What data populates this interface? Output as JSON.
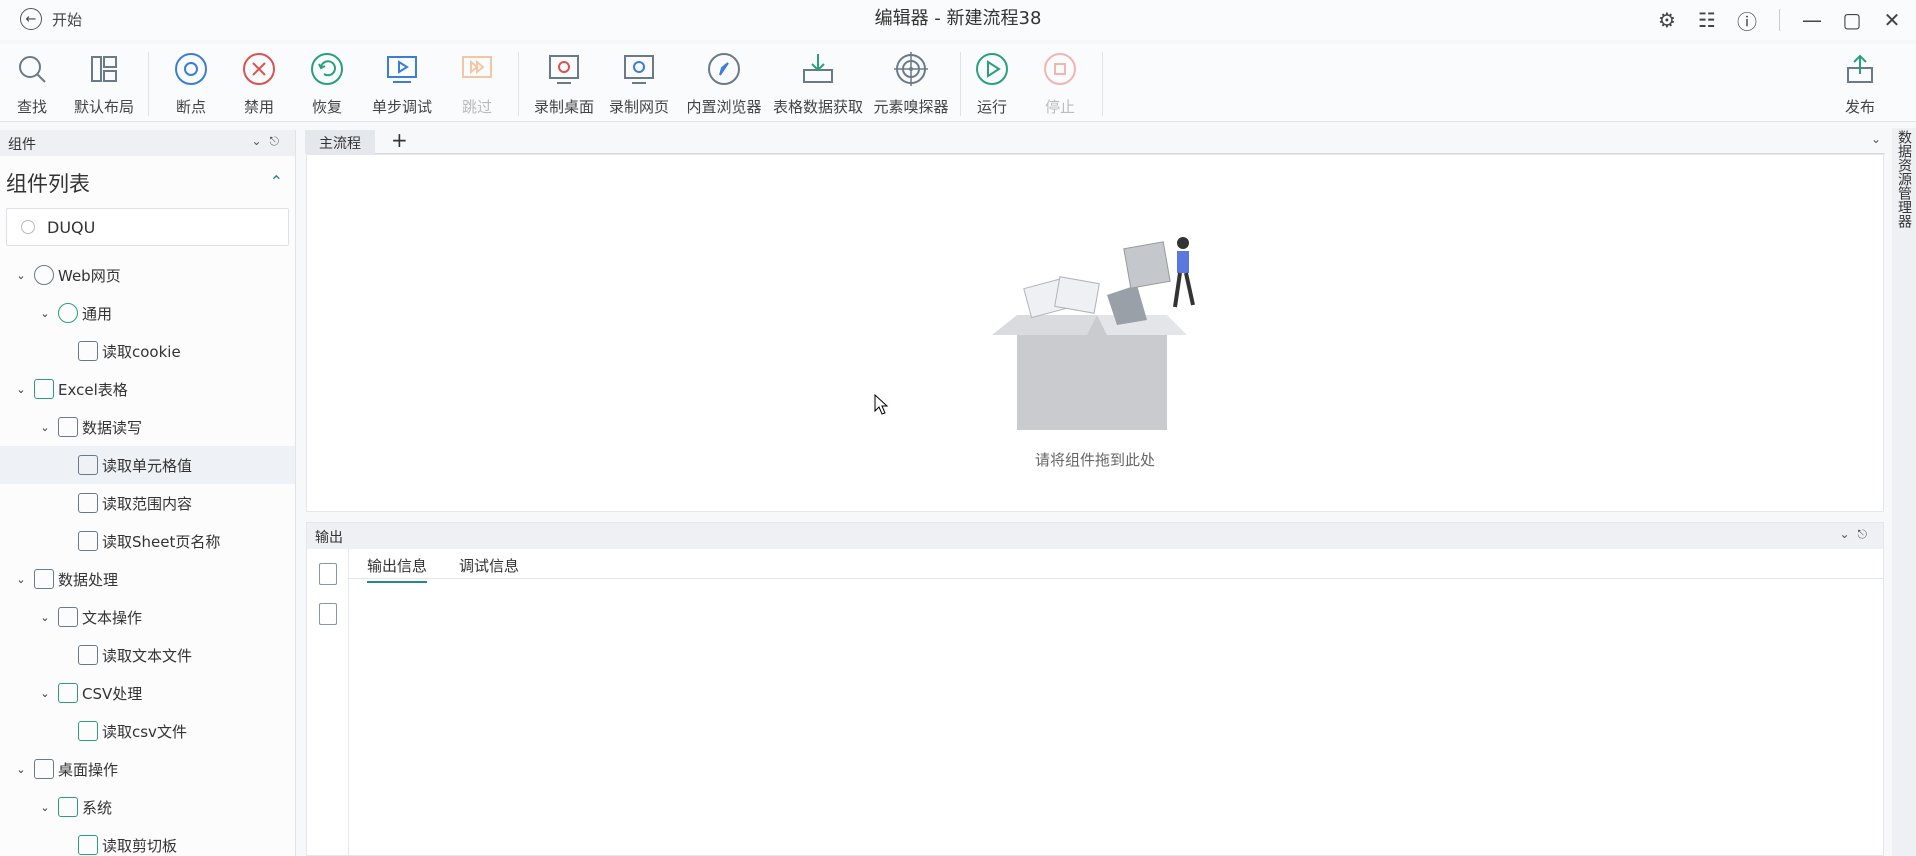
{
  "window": {
    "back_label": "开始",
    "title": "编辑器 - 新建流程38"
  },
  "toolbar": {
    "find": "查找",
    "default_layout": "默认布局",
    "breakpoint": "断点",
    "disable": "禁用",
    "restore": "恢复",
    "step_debug": "单步调试",
    "skip": "跳过",
    "record_desktop": "录制桌面",
    "record_web": "录制网页",
    "builtin_browser": "内置浏览器",
    "table_data": "表格数据获取",
    "element_sniffer": "元素嗅探器",
    "run": "运行",
    "stop": "停止",
    "publish": "发布"
  },
  "components": {
    "panel_label": "组件",
    "title": "组件列表",
    "search_value": "DUQU",
    "tree": [
      {
        "label": "Web网页",
        "level": 0
      },
      {
        "label": "通用",
        "level": 1
      },
      {
        "label": "读取cookie",
        "level": 2
      },
      {
        "label": "Excel表格",
        "level": 0
      },
      {
        "label": "数据读写",
        "level": 1
      },
      {
        "label": "读取单元格值",
        "level": 2
      },
      {
        "label": "读取范围内容",
        "level": 2
      },
      {
        "label": "读取Sheet页名称",
        "level": 2
      },
      {
        "label": "数据处理",
        "level": 0
      },
      {
        "label": "文本操作",
        "level": 1
      },
      {
        "label": "读取文本文件",
        "level": 2
      },
      {
        "label": "CSV处理",
        "level": 1
      },
      {
        "label": "读取csv文件",
        "level": 2
      },
      {
        "label": "桌面操作",
        "level": 0
      },
      {
        "label": "系统",
        "level": 1
      },
      {
        "label": "读取剪切板",
        "level": 2
      }
    ]
  },
  "editor": {
    "main_tab": "主流程",
    "add_tab": "+",
    "empty_hint": "请将组件拖到此处"
  },
  "right_rail": {
    "label": "数据资源管理器"
  },
  "output": {
    "label": "输出",
    "tabs": [
      "输出信息",
      "调试信息"
    ]
  },
  "colors": {
    "accent": "#2a8a7d",
    "danger": "#d9534f",
    "primary": "#3b7dd8"
  }
}
